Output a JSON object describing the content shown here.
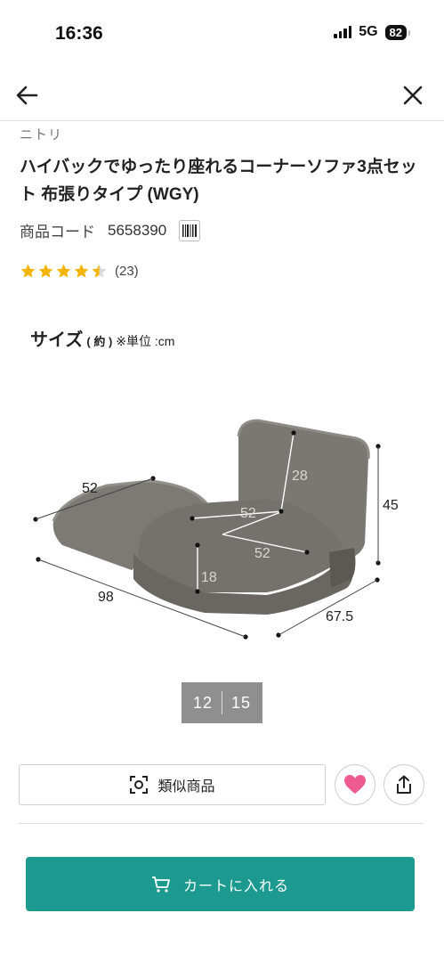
{
  "status_bar": {
    "time": "16:36",
    "network": "5G",
    "battery": "82"
  },
  "nav": {
    "back_icon": "arrow-left-icon",
    "close_icon": "close-icon"
  },
  "product": {
    "brand": "ニトリ",
    "title": "ハイバックでゆったり座れるコーナーソファ3点セット 布張りタイプ (WGY)",
    "code_label": "商品コード",
    "code_value": "5658390",
    "rating": 4.5,
    "review_count": "(23)"
  },
  "size_image": {
    "title": "サイズ",
    "unit": "( 約 )",
    "note": "※単位 :cm",
    "labels": {
      "left_depth": "52",
      "left_length": "98",
      "back_height": "28",
      "seat_width": "52",
      "seat_depth": "52",
      "seat_height": "18",
      "total_height": "45",
      "total_depth": "67.5"
    }
  },
  "pager": {
    "current": "12",
    "total": "15"
  },
  "actions": {
    "similar_label": "類似商品",
    "cart_label": "カートに入れる"
  },
  "colors": {
    "accent": "#1d9a8f",
    "heart": "#ef5b8e",
    "star": "#f5b400",
    "pager_bg": "#8f8f8f"
  }
}
